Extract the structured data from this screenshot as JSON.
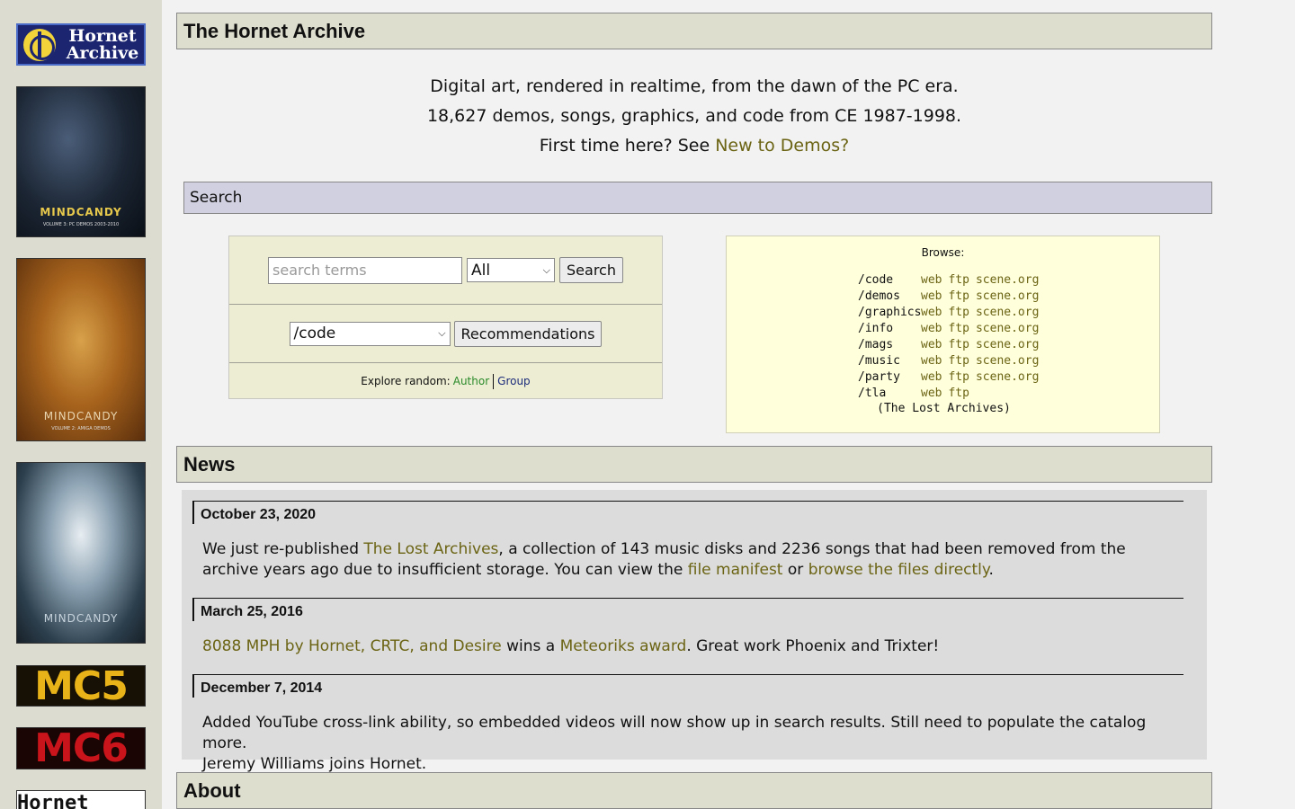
{
  "sidebar": {
    "logo_text": "Hornet Archive",
    "covers": [
      {
        "title": "MINDCANDY",
        "subtitle": "VOLUME 3: PC DEMOS 2003-2010"
      },
      {
        "title": "MINDCANDY",
        "subtitle": "VOLUME 2: AMIGA DEMOS"
      },
      {
        "title": "MINDCANDY",
        "subtitle": ""
      }
    ],
    "mc5_label": "MC5",
    "mc6_label": "MC6",
    "mods_label": "Hornet MODS"
  },
  "header": {
    "title": "The Hornet Archive"
  },
  "intro": {
    "line1": "Digital art, rendered in realtime, from the dawn of the PC era.",
    "line2": "18,627 demos, songs, graphics, and code from CE 1987-1998.",
    "line3_prefix": "First time here? See ",
    "line3_link": "New to Demos?"
  },
  "search": {
    "section_title": "Search",
    "input_placeholder": "search terms",
    "input_value": "",
    "scope_selected": "All",
    "search_button": "Search",
    "dir_selected": "/code",
    "recommend_button": "Recommendations",
    "explore_label": "Explore random:",
    "explore_author": "Author",
    "explore_group": "Group"
  },
  "browse": {
    "label": "Browse:",
    "rows": [
      {
        "path": "/code",
        "links": [
          "web",
          "ftp",
          "scene.org"
        ]
      },
      {
        "path": "/demos",
        "links": [
          "web",
          "ftp",
          "scene.org"
        ]
      },
      {
        "path": "/graphics",
        "links": [
          "web",
          "ftp",
          "scene.org"
        ]
      },
      {
        "path": "/info",
        "links": [
          "web",
          "ftp",
          "scene.org"
        ]
      },
      {
        "path": "/mags",
        "links": [
          "web",
          "ftp",
          "scene.org"
        ]
      },
      {
        "path": "/music",
        "links": [
          "web",
          "ftp",
          "scene.org"
        ]
      },
      {
        "path": "/party",
        "links": [
          "web",
          "ftp",
          "scene.org"
        ]
      },
      {
        "path": "/tla",
        "links": [
          "web",
          "ftp"
        ]
      }
    ],
    "lost_archives": "(The Lost Archives)"
  },
  "news": {
    "section_title": "News",
    "items": [
      {
        "date": "October 23, 2020",
        "t1": "We just re-published ",
        "l1": "The Lost Archives",
        "t2": ", a collection of 143 music disks and 2236 songs that had been removed from the archive years ago due to insufficient storage. You can view the ",
        "l2": "file manifest",
        "t3": " or ",
        "l3": "browse the files directly",
        "t4": "."
      },
      {
        "date": "March 25, 2016",
        "l1": "8088 MPH by Hornet, CRTC, and Desire",
        "t1": " wins a ",
        "l2": "Meteoriks award",
        "t2": ". Great work Phoenix and Trixter!"
      },
      {
        "date": "December 7, 2014",
        "line1": "Added YouTube cross-link ability, so embedded videos will now show up in search results. Still need to populate the catalog more.",
        "line2": "Jeremy Williams joins Hornet."
      }
    ]
  },
  "about": {
    "section_title": "About"
  }
}
